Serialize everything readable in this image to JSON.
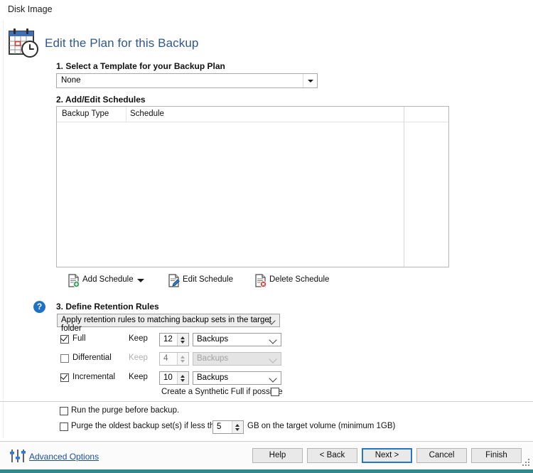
{
  "window": {
    "title": "Disk Image"
  },
  "header": {
    "icon": "calendar-clock-icon",
    "title": "Edit the Plan for this Backup"
  },
  "step1": {
    "heading": "1. Select a Template for your Backup Plan",
    "template_combo": {
      "value": "None",
      "arrow_icon": "triangle-down-icon"
    }
  },
  "step2": {
    "heading": "2. Add/Edit Schedules",
    "grid": {
      "columns": [
        "Backup Type",
        "Schedule"
      ],
      "rows": []
    },
    "toolbar": {
      "add": {
        "label": "Add Schedule",
        "icon": "document-add-icon",
        "split_icon": "triangle-down-icon"
      },
      "edit": {
        "label": "Edit Schedule",
        "icon": "document-edit-icon"
      },
      "delete": {
        "label": "Delete Schedule",
        "icon": "document-delete-icon"
      }
    }
  },
  "step3": {
    "help_icon": "question-mark-icon",
    "heading": "3. Define Retention Rules",
    "scope_combo": {
      "value": "Apply retention rules to matching backup sets in the target folder",
      "arrow_icon": "chevron-down-icon"
    },
    "rules": [
      {
        "name": "full",
        "label": "Full",
        "checked": true,
        "enabled": true,
        "keep_label": "Keep",
        "count": "12",
        "unit": "Backups"
      },
      {
        "name": "differential",
        "label": "Differential",
        "checked": false,
        "enabled": false,
        "keep_label": "Keep",
        "count": "4",
        "unit": "Backups"
      },
      {
        "name": "incremental",
        "label": "Incremental",
        "checked": true,
        "enabled": true,
        "keep_label": "Keep",
        "count": "10",
        "unit": "Backups"
      }
    ],
    "synthetic_full": {
      "label": "Create a Synthetic Full if possible",
      "checked": false
    }
  },
  "purge": {
    "run_before": {
      "label": "Run the purge before backup.",
      "checked": false
    },
    "oldest": {
      "label_before": "Purge the oldest backup set(s) if less than",
      "value": "5",
      "label_after": "GB on the target volume (minimum 1GB)",
      "checked": false
    }
  },
  "footer": {
    "advanced_icon": "sliders-icon",
    "advanced_label": "Advanced Options",
    "buttons": [
      {
        "name": "help",
        "label": "Help",
        "focused": false
      },
      {
        "name": "back",
        "label": "< Back",
        "focused": false
      },
      {
        "name": "next",
        "label": "Next >",
        "focused": true
      },
      {
        "name": "cancel",
        "label": "Cancel",
        "focused": false
      },
      {
        "name": "finish",
        "label": "Finish",
        "focused": false
      }
    ]
  },
  "colors": {
    "header_title": "#31578f",
    "link": "#1b4f9c",
    "focus_border": "#2678c4",
    "help_badge": "#1f71c4",
    "taskbar": "#2f8a8f"
  }
}
